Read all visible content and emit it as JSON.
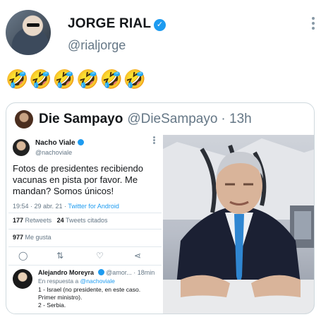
{
  "author": {
    "name": "JORGE RIAL",
    "handle": "@rialjorge"
  },
  "tweet": {
    "emojis": "🤣🤣🤣🤣🤣🤣"
  },
  "quoted": {
    "name": "Die Sampayo",
    "handle": "@DieSampayo",
    "time": "· 13h",
    "embedded": {
      "author_name": "Nacho Viale",
      "author_handle": "@nachoviale",
      "text": "Fotos de presidentes recibiendo vacunas en pista por favor. Me mandan? Somos únicos!",
      "time": "19:54 · 29 abr. 21 ·",
      "source": "Twitter for Android",
      "retweets_count": "177",
      "retweets_label": "Retweets",
      "quotes_count": "24",
      "quotes_label": "Tweets citados",
      "likes_count": "977",
      "likes_label": "Me gusta",
      "reply": {
        "name": "Alejandro Moreyra",
        "handle": "@amor...",
        "time": "· 18min",
        "in_reply_prefix": "En respuesta a",
        "in_reply_handle": "@nachoviale",
        "line1": "1 - Israel (no presidente, en este caso. Primer ministro).",
        "line2": "2 - Serbia."
      }
    }
  },
  "colors": {
    "verified": "#1d9bf0",
    "muted": "#657786",
    "border": "#cfd9de"
  }
}
